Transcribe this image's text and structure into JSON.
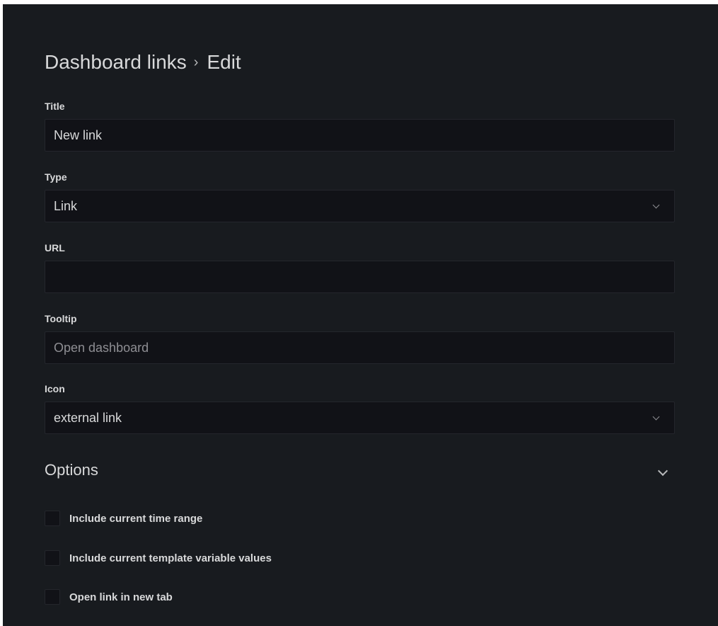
{
  "header": {
    "breadcrumb_parent": "Dashboard links",
    "breadcrumb_separator": "›",
    "breadcrumb_current": "Edit"
  },
  "form": {
    "title": {
      "label": "Title",
      "value": "New link"
    },
    "type": {
      "label": "Type",
      "value": "Link",
      "icon": "chevron-down-icon"
    },
    "url": {
      "label": "URL",
      "value": ""
    },
    "tooltip": {
      "label": "Tooltip",
      "value": "",
      "placeholder": "Open dashboard"
    },
    "icon": {
      "label": "Icon",
      "value": "external link",
      "icon": "chevron-down-icon"
    }
  },
  "options": {
    "title": "Options",
    "toggle_icon": "chevron-down-icon",
    "checkboxes": [
      {
        "label": "Include current time range",
        "checked": false
      },
      {
        "label": "Include current template variable values",
        "checked": false
      },
      {
        "label": "Open link in new tab",
        "checked": false
      }
    ]
  },
  "colors": {
    "background": "#181b1f",
    "input_background": "#111217",
    "input_border": "#24262c",
    "text": "#d8d9da",
    "placeholder": "#8e8e93"
  }
}
